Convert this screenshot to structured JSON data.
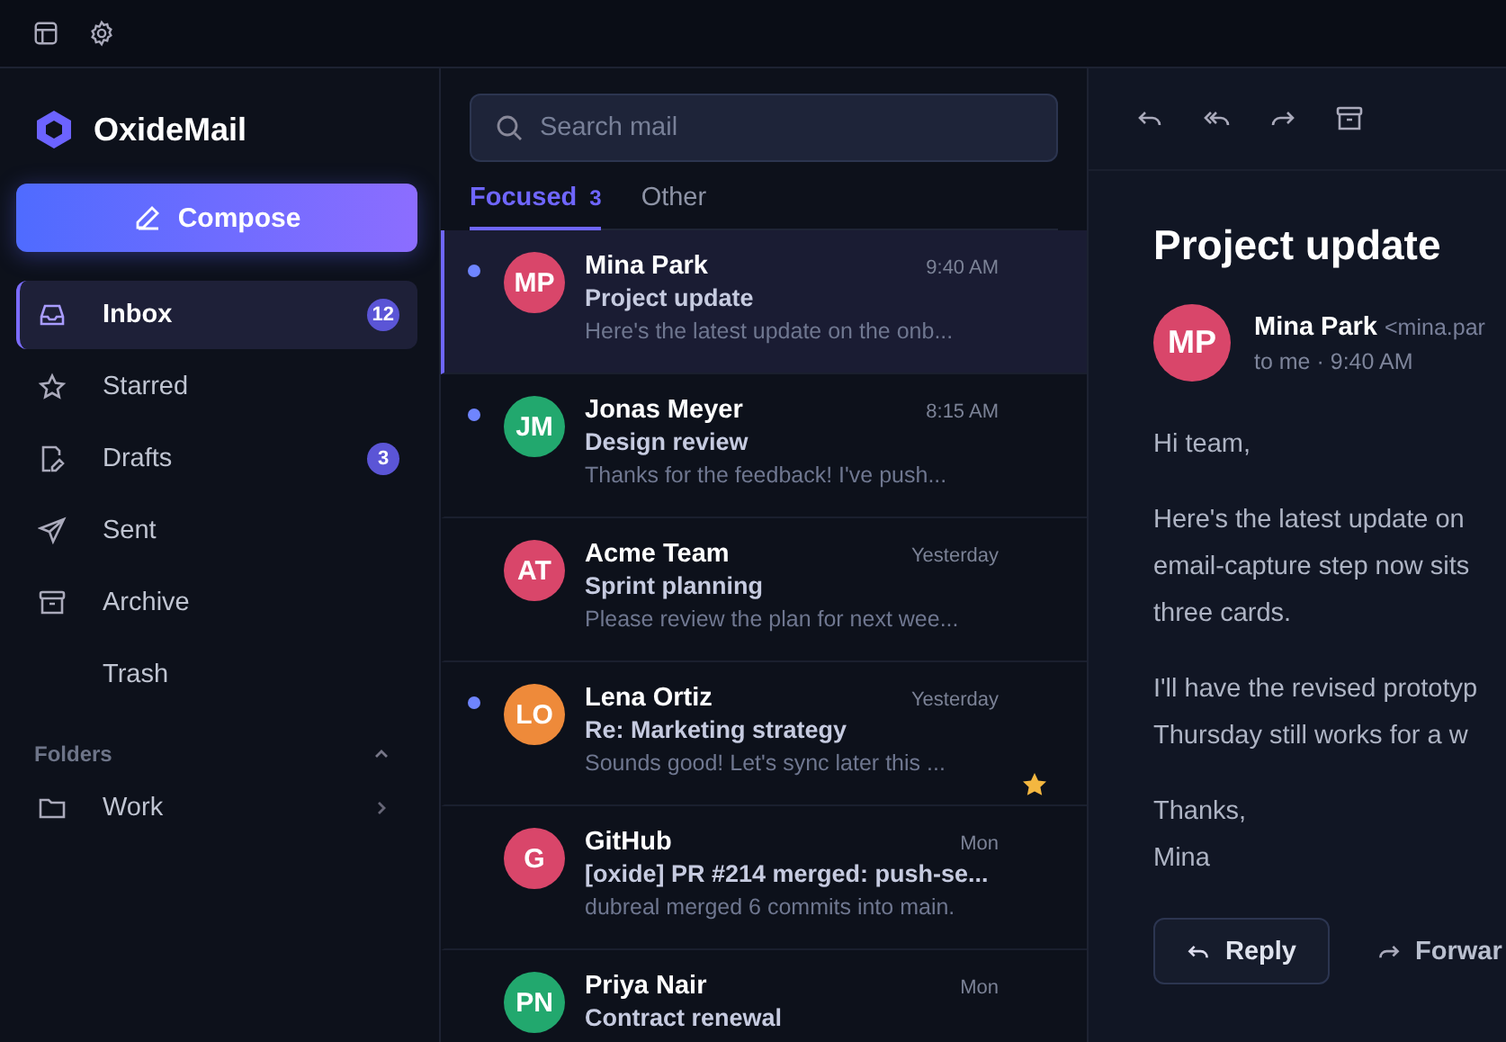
{
  "app": {
    "name": "OxideMail"
  },
  "compose": {
    "label": "Compose"
  },
  "sidebar": {
    "items": [
      {
        "kind": "inbox",
        "label": "Inbox",
        "badge": "12",
        "selected": true
      },
      {
        "kind": "star",
        "label": "Starred",
        "selected": false
      },
      {
        "kind": "drafts",
        "label": "Drafts",
        "badge": "3",
        "selected": false
      },
      {
        "kind": "sent",
        "label": "Sent",
        "selected": false
      },
      {
        "kind": "archive",
        "label": "Archive",
        "selected": false
      },
      {
        "kind": "none",
        "label": "Trash",
        "selected": false
      }
    ],
    "folders": {
      "title": "Folders",
      "expanded": true,
      "items": [
        {
          "label": "Work"
        }
      ]
    }
  },
  "search": {
    "placeholder": "Search mail"
  },
  "tabs": [
    {
      "label": "Focused",
      "count": "3",
      "selected": true
    },
    {
      "label": "Other",
      "selected": false
    }
  ],
  "messages": [
    {
      "initials": "MP",
      "color": "#d9466a",
      "sender": "Mina Park",
      "time": "9:40 AM",
      "subject": "Project update",
      "preview": "Here's the latest update on the onb...",
      "unread": true,
      "selected": true,
      "starred": false
    },
    {
      "initials": "JM",
      "color": "#22a86e",
      "sender": "Jonas Meyer",
      "time": "8:15 AM",
      "subject": "Design review",
      "preview": "Thanks for the feedback! I've push...",
      "unread": true,
      "selected": false,
      "starred": false
    },
    {
      "initials": "AT",
      "color": "#d9466a",
      "sender": "Acme Team",
      "time": "Yesterday",
      "subject": "Sprint planning",
      "preview": "Please review the plan for next wee...",
      "unread": false,
      "selected": false,
      "starred": false
    },
    {
      "initials": "LO",
      "color": "#ee8a3a",
      "sender": "Lena Ortiz",
      "time": "Yesterday",
      "subject": "Re: Marketing strategy",
      "preview": "Sounds good! Let's sync later this ...",
      "unread": true,
      "selected": false,
      "starred": true
    },
    {
      "initials": "G",
      "color": "#d9466a",
      "sender": "GitHub",
      "time": "Mon",
      "subject": "[oxide] PR #214 merged: push-se...",
      "preview": "dubreal merged 6 commits into main.",
      "unread": false,
      "selected": false,
      "starred": false
    },
    {
      "initials": "PN",
      "color": "#22a86e",
      "sender": "Priya Nair",
      "time": "Mon",
      "subject": "Contract renewal",
      "unread": false,
      "selected": false,
      "starred": false
    }
  ],
  "reader": {
    "subject": "Project update",
    "initials": "MP",
    "color": "#d9466a",
    "sender": "Mina Park",
    "address": "<mina.par",
    "meta": "to me · 9:40 AM",
    "paragraphs": [
      [
        "Hi team,"
      ],
      [
        "Here's the latest update on",
        "email-capture step now sits",
        "three cards."
      ],
      [
        "I'll have the revised prototyp",
        "Thursday still works for a w"
      ],
      [
        "Thanks,",
        "Mina"
      ]
    ],
    "actions": [
      {
        "kind": "reply",
        "label": "Reply"
      },
      {
        "kind": "forward",
        "label": "Forwar"
      }
    ]
  }
}
